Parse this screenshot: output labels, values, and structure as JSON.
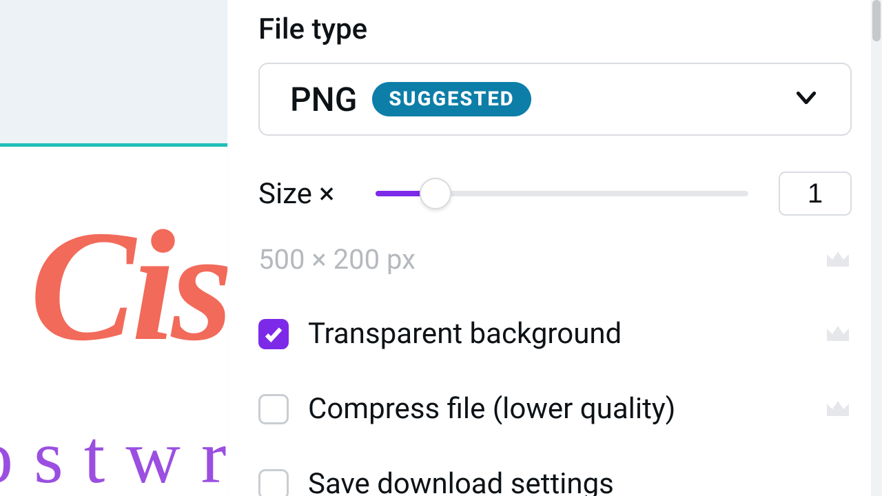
{
  "canvas": {
    "script_text": "n Cis",
    "sub_text": "ostwri"
  },
  "panel": {
    "file_type_label": "File type",
    "file_type_value": "PNG",
    "file_type_badge": "SUGGESTED",
    "size_label": "Size",
    "size_mult_symbol": "×",
    "size_value": "1",
    "dimensions": "500 × 200 px",
    "options": {
      "transparent_bg": "Transparent background",
      "compress": "Compress file (lower quality)",
      "save_settings": "Save download settings"
    }
  }
}
